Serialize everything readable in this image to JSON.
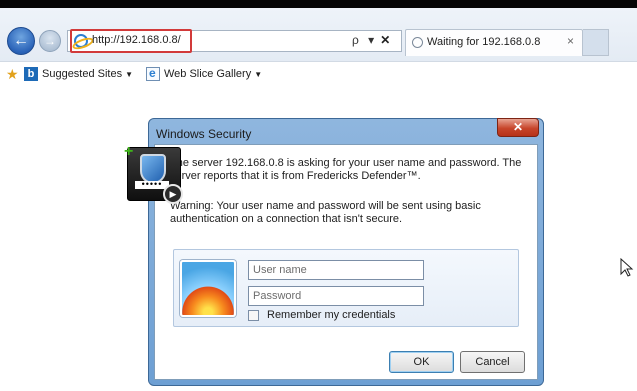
{
  "browser": {
    "url": "http://192.168.0.8/",
    "tab_title": "Waiting for 192.168.0.8",
    "tab_close": "×",
    "address_tools": "ρ ▾",
    "address_stop": "✕",
    "favorites": [
      {
        "label": "Suggested Sites",
        "icon": "bing-icon"
      },
      {
        "label": "Web Slice Gallery",
        "icon": "web-slice-icon"
      }
    ],
    "back_glyph": "←",
    "forward_glyph": "→",
    "fav_caret": "▼"
  },
  "dialog": {
    "title": "Windows Security",
    "close_glyph": "✕",
    "message_1": "The server 192.168.0.8 is asking for your user name and password. The server reports that it is from Fredericks Defender™.",
    "message_2": "Warning: Your user name and password will be sent using basic authentication on a connection that isn't secure.",
    "username_placeholder": "User name",
    "password_placeholder": "Password",
    "remember_label": "Remember my credentials",
    "ok_label": "OK",
    "cancel_label": "Cancel",
    "shield_dots": "•••••",
    "shield_plus": "+",
    "shield_play": "▶"
  },
  "colors": {
    "highlight_box": "#d23a3a",
    "dialog_frame": "#6d9fd3",
    "close_button": "#c7452a"
  }
}
